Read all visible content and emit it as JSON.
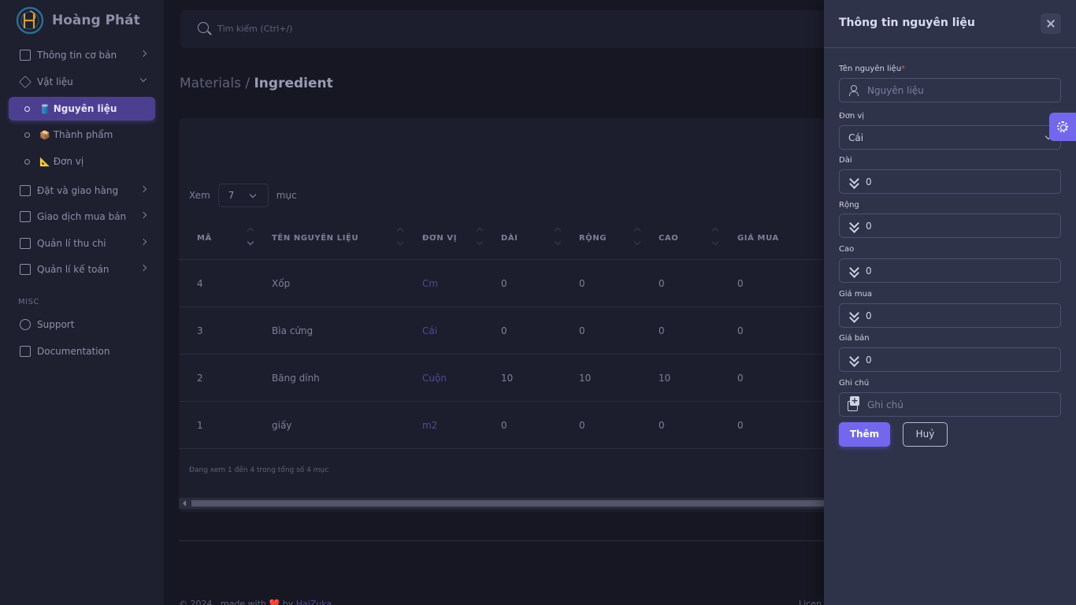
{
  "brand": {
    "name": "Hoàng Phát"
  },
  "sidebar": {
    "items": [
      {
        "label": "Thông tin cơ bản"
      },
      {
        "label": "Vật liệu"
      },
      {
        "label": "Nguyên liệu",
        "emoji": "🛢️"
      },
      {
        "label": "Thành phẩm",
        "emoji": "📦"
      },
      {
        "label": "Đơn vị",
        "emoji": "📐"
      },
      {
        "label": "Đặt và giao hàng"
      },
      {
        "label": "Giao dịch mua bán"
      },
      {
        "label": "Quản lí thu chi"
      },
      {
        "label": "Quản lí kế toán"
      }
    ],
    "misc_header": "MISC",
    "misc_items": [
      {
        "label": "Support"
      },
      {
        "label": "Documentation"
      }
    ]
  },
  "search": {
    "placeholder": "Tìm kiếm (Ctrl+/)"
  },
  "breadcrumb": {
    "parent": "Materials /",
    "current": "Ingredient"
  },
  "table": {
    "show_label": "Xem",
    "page_size": "7",
    "entries_label": "mục",
    "columns": [
      "MÃ",
      "TÊN NGUYÊN LIỆU",
      "ĐƠN VỊ",
      "DÀI",
      "RỘNG",
      "CAO",
      "GIÁ MUA"
    ],
    "rows": [
      {
        "id": "4",
        "name": "Xốp",
        "unit": "Cm",
        "length": "0",
        "width": "0",
        "height": "0",
        "price": "0"
      },
      {
        "id": "3",
        "name": "Bìa cứng",
        "unit": "Cái",
        "length": "0",
        "width": "0",
        "height": "0",
        "price": "0"
      },
      {
        "id": "2",
        "name": "Băng dính",
        "unit": "Cuộn",
        "length": "10",
        "width": "10",
        "height": "10",
        "price": "0"
      },
      {
        "id": "1",
        "name": "giấy",
        "unit": "m2",
        "length": "0",
        "width": "0",
        "height": "0",
        "price": "0"
      }
    ],
    "info": "Đang xem 1 đến 4 trong tổng số 4 mục"
  },
  "footer": {
    "copyright": "© 2024 , made with",
    "heart": "❤️",
    "by": "by",
    "author": "HaiZuka",
    "right": "Licen"
  },
  "drawer": {
    "title": "Thông tin nguyên liệu",
    "fields": {
      "name": {
        "label": "Tên nguyên liệu",
        "required": "*",
        "placeholder": "Nguyên liệu"
      },
      "unit": {
        "label": "Đơn vị",
        "value": "Cái"
      },
      "length": {
        "label": "Dài",
        "value": "0"
      },
      "width": {
        "label": "Rộng",
        "value": "0"
      },
      "height": {
        "label": "Cao",
        "value": "0"
      },
      "buy_price": {
        "label": "Giá mua",
        "value": "0"
      },
      "sell_price": {
        "label": "Giá bán",
        "value": "0"
      },
      "note": {
        "label": "Ghi chú",
        "placeholder": "Ghi chú"
      }
    },
    "submit_label": "Thêm",
    "cancel_label": "Huỷ"
  },
  "colors": {
    "primary": "#7367f0",
    "drawer_bg": "#2f3349",
    "page_bg": "#171723"
  }
}
